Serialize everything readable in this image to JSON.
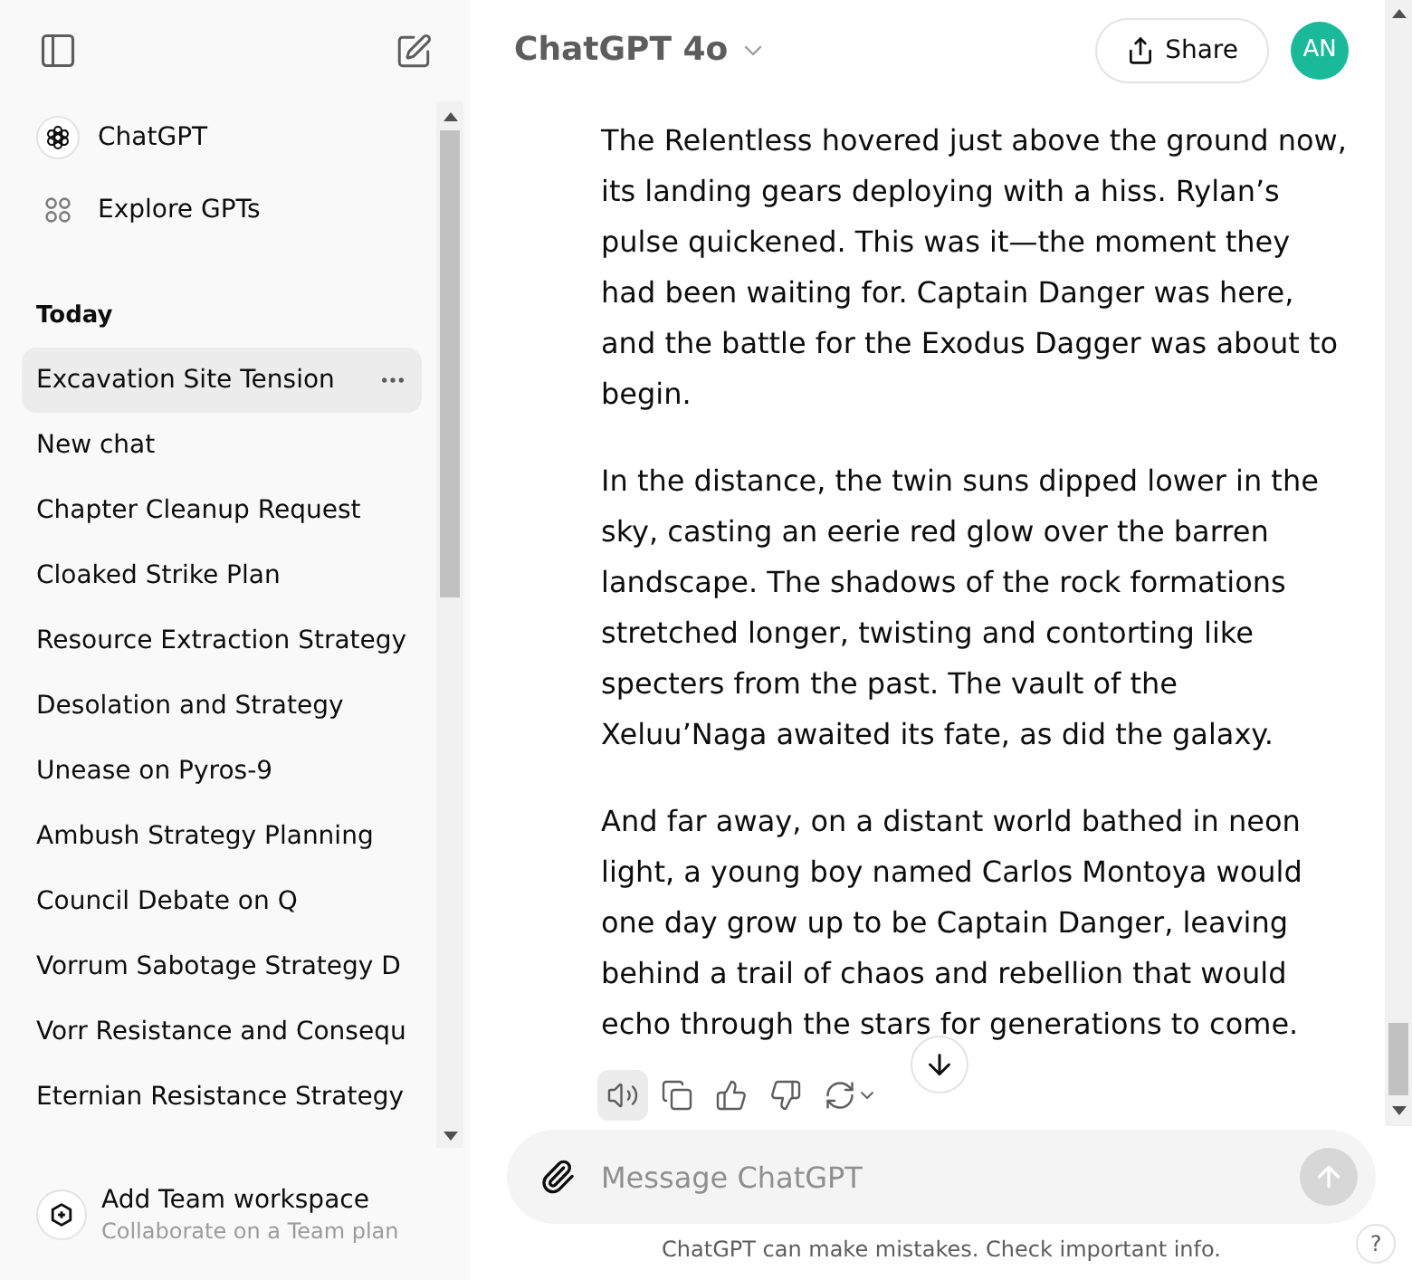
{
  "sidebar": {
    "top_items": [
      {
        "kind": "logo",
        "label": "ChatGPT"
      },
      {
        "kind": "grid",
        "label": "Explore GPTs"
      }
    ],
    "section_title": "Today",
    "history": [
      {
        "title": "Excavation Site Tension",
        "selected": true
      },
      {
        "title": "New chat",
        "selected": false
      },
      {
        "title": "Chapter Cleanup Request",
        "selected": false
      },
      {
        "title": "Cloaked Strike Plan",
        "selected": false
      },
      {
        "title": "Resource Extraction Strategy",
        "selected": false
      },
      {
        "title": "Desolation and Strategy",
        "selected": false
      },
      {
        "title": "Unease on Pyros-9",
        "selected": false
      },
      {
        "title": "Ambush Strategy Planning",
        "selected": false
      },
      {
        "title": "Council Debate on Q",
        "selected": false
      },
      {
        "title": "Vorrum Sabotage Strategy D",
        "selected": false
      },
      {
        "title": "Vorr Resistance and Consequ",
        "selected": false
      },
      {
        "title": "Eternian Resistance Strategy",
        "selected": false
      }
    ],
    "workspace": {
      "title": "Add Team workspace",
      "subtitle": "Collaborate on a Team plan"
    }
  },
  "header": {
    "model": "ChatGPT 4o",
    "share": "Share",
    "avatar": "AN"
  },
  "message": {
    "paragraphs": [
      "The Relentless hovered just above the ground now, its landing gears deploying with a hiss. Rylan’s pulse quickened. This was it—the moment they had been waiting for. Captain Danger was here, and the battle for the Exodus Dagger was about to begin.",
      "In the distance, the twin suns dipped lower in the sky, casting an eerie red glow over the barren landscape. The shadows of the rock formations stretched longer, twisting and contorting like specters from the past. The vault of the Xeluu’Naga awaited its fate, as did the galaxy.",
      "And far away, on a distant world bathed in neon light, a young boy named Carlos Montoya would one day grow up to be Captain Danger, leaving behind a trail of chaos and rebellion that would echo through the stars for generations to come."
    ],
    "actions": [
      {
        "kind": "read_aloud",
        "highlighted": true
      },
      {
        "kind": "copy",
        "highlighted": false
      },
      {
        "kind": "like",
        "highlighted": false
      },
      {
        "kind": "dislike",
        "highlighted": false
      },
      {
        "kind": "regenerate",
        "highlighted": false
      }
    ]
  },
  "composer": {
    "placeholder": "Message ChatGPT"
  },
  "footer": {
    "disclaimer": "ChatGPT can make mistakes. Check important info.",
    "help": "?"
  }
}
